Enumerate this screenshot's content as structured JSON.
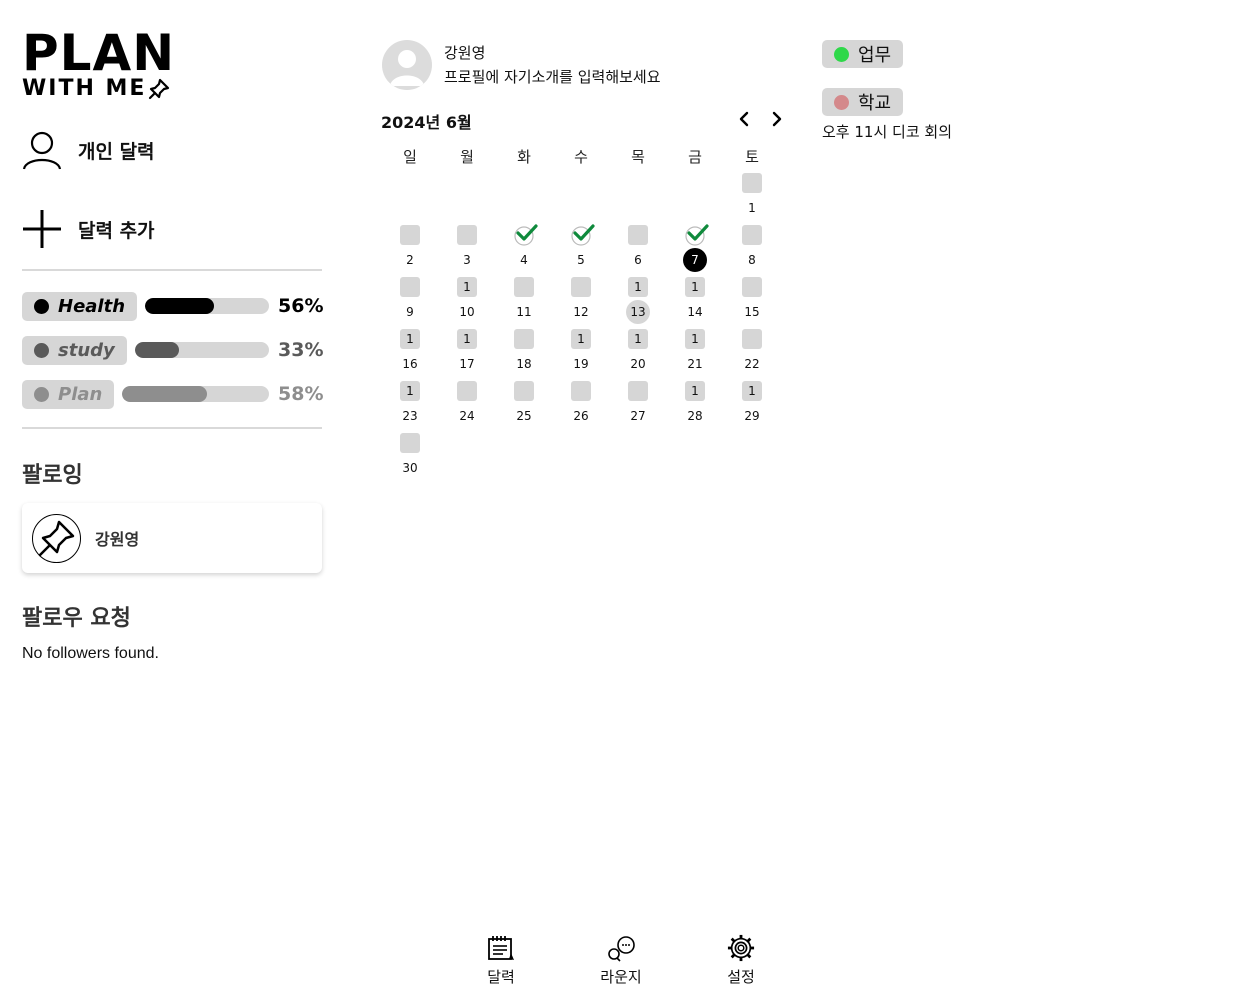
{
  "logo": {
    "line1": "PLAN",
    "line2": "WITH ME"
  },
  "sidebar": {
    "personal_calendar": "개인 달력",
    "add_calendar": "달력 추가"
  },
  "categories": [
    {
      "name": "Health",
      "percent": 56,
      "percent_label": "56%",
      "color": "#000000",
      "label_color": "#000000"
    },
    {
      "name": "study",
      "percent": 33,
      "percent_label": "33%",
      "color": "#5a5a5a",
      "label_color": "#5a5a5a"
    },
    {
      "name": "Plan",
      "percent": 58,
      "percent_label": "58%",
      "color": "#8e8e8e",
      "label_color": "#8e8e8e"
    }
  ],
  "following": {
    "title": "팔로잉",
    "users": [
      {
        "name": "강원영"
      }
    ]
  },
  "follow_requests": {
    "title": "팔로우 요청",
    "empty_text": "No followers found."
  },
  "profile": {
    "name": "강원영",
    "bio": "프로필에 자기소개를 입력해보세요"
  },
  "calendar": {
    "month_label": "2024년 6월",
    "weekdays": [
      "일",
      "월",
      "화",
      "수",
      "목",
      "금",
      "토"
    ],
    "first_weekday_index": 6,
    "days": [
      {
        "day": "1",
        "count": "",
        "checked": false
      },
      {
        "day": "2",
        "count": "",
        "checked": false
      },
      {
        "day": "3",
        "count": "",
        "checked": false
      },
      {
        "day": "4",
        "count": "",
        "checked": true
      },
      {
        "day": "5",
        "count": "",
        "checked": true
      },
      {
        "day": "6",
        "count": "",
        "checked": false
      },
      {
        "day": "7",
        "count": "",
        "checked": true,
        "today": true
      },
      {
        "day": "8",
        "count": "",
        "checked": false
      },
      {
        "day": "9",
        "count": "",
        "checked": false
      },
      {
        "day": "10",
        "count": "1",
        "checked": false
      },
      {
        "day": "11",
        "count": "",
        "checked": false
      },
      {
        "day": "12",
        "count": "",
        "checked": false
      },
      {
        "day": "13",
        "count": "1",
        "checked": false,
        "highlight": true
      },
      {
        "day": "14",
        "count": "1",
        "checked": false
      },
      {
        "day": "15",
        "count": "",
        "checked": false
      },
      {
        "day": "16",
        "count": "1",
        "checked": false
      },
      {
        "day": "17",
        "count": "1",
        "checked": false
      },
      {
        "day": "18",
        "count": "",
        "checked": false
      },
      {
        "day": "19",
        "count": "1",
        "checked": false
      },
      {
        "day": "20",
        "count": "1",
        "checked": false
      },
      {
        "day": "21",
        "count": "1",
        "checked": false
      },
      {
        "day": "22",
        "count": "",
        "checked": false
      },
      {
        "day": "23",
        "count": "1",
        "checked": false
      },
      {
        "day": "24",
        "count": "",
        "checked": false
      },
      {
        "day": "25",
        "count": "",
        "checked": false
      },
      {
        "day": "26",
        "count": "",
        "checked": false
      },
      {
        "day": "27",
        "count": "",
        "checked": false
      },
      {
        "day": "28",
        "count": "1",
        "checked": false
      },
      {
        "day": "29",
        "count": "1",
        "checked": false
      },
      {
        "day": "30",
        "count": "",
        "checked": false
      }
    ]
  },
  "tags": [
    {
      "label": "업무",
      "color": "#2fd84a"
    },
    {
      "label": "학교",
      "color": "#d4898b"
    }
  ],
  "event": {
    "text": "오후 11시 디코 회의"
  },
  "bottom_nav": {
    "calendar": "달력",
    "lounge": "라운지",
    "settings": "설정"
  },
  "colors": {
    "check": "#0f8a3c",
    "chip_bg": "#d6d6d6"
  }
}
